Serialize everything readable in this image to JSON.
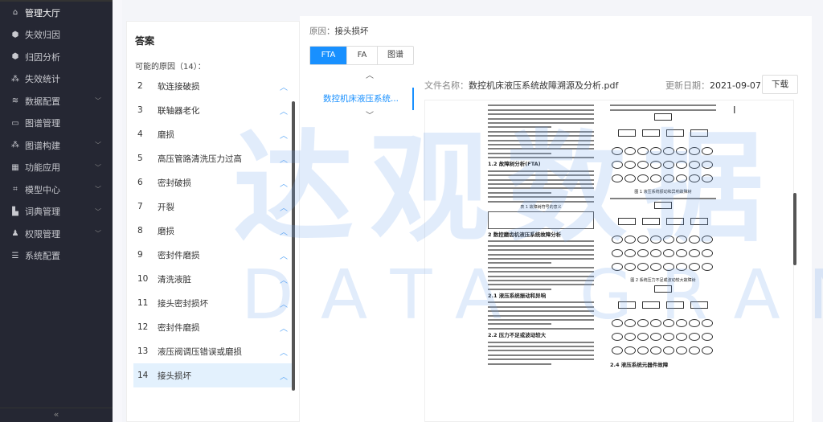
{
  "sidebar": {
    "items": [
      {
        "label": "管理大厅",
        "icon": "home-icon",
        "has_children": false
      },
      {
        "label": "失效归因",
        "icon": "cube-icon",
        "has_children": false
      },
      {
        "label": "归因分析",
        "icon": "cube-icon",
        "has_children": false
      },
      {
        "label": "失效统计",
        "icon": "nodes-icon",
        "has_children": false
      },
      {
        "label": "数据配置",
        "icon": "database-icon",
        "has_children": true
      },
      {
        "label": "图谱管理",
        "icon": "monitor-icon",
        "has_children": false
      },
      {
        "label": "图谱构建",
        "icon": "nodes-icon",
        "has_children": true
      },
      {
        "label": "功能应用",
        "icon": "grid-icon",
        "has_children": true
      },
      {
        "label": "模型中心",
        "icon": "network-icon",
        "has_children": true
      },
      {
        "label": "词典管理",
        "icon": "book-icon",
        "has_children": true
      },
      {
        "label": "权限管理",
        "icon": "user-lock-icon",
        "has_children": true
      },
      {
        "label": "系统配置",
        "icon": "settings-panel-icon",
        "has_children": false
      }
    ],
    "collapse": "«"
  },
  "answer": {
    "title": "答案",
    "count_label": "可能的原因（14）：",
    "items": [
      {
        "num": "2",
        "label": "软连接破损"
      },
      {
        "num": "3",
        "label": "联轴器老化"
      },
      {
        "num": "4",
        "label": "磨损"
      },
      {
        "num": "5",
        "label": "高压管路清洗压力过高"
      },
      {
        "num": "6",
        "label": "密封破损"
      },
      {
        "num": "7",
        "label": "开裂"
      },
      {
        "num": "8",
        "label": "磨损"
      },
      {
        "num": "9",
        "label": "密封件磨损"
      },
      {
        "num": "10",
        "label": "清洗液脏"
      },
      {
        "num": "11",
        "label": "接头密封损坏"
      },
      {
        "num": "12",
        "label": "密封件磨损"
      },
      {
        "num": "13",
        "label": "液压阀调压错误或磨损"
      },
      {
        "num": "14",
        "label": "接头损坏",
        "selected": true
      }
    ]
  },
  "detail": {
    "reason_label": "原因：",
    "reason_value": "接头损坏",
    "tabs": [
      {
        "label": "FTA",
        "active": true
      },
      {
        "label": "FA"
      },
      {
        "label": "图谱"
      }
    ],
    "documents": [
      {
        "label": "数控机床液压系统...",
        "active": true
      }
    ],
    "file_label": "文件名称：",
    "file_name": "数控机床液压系统故障溯源及分析.pdf",
    "date_label": "更新日期：",
    "date": "2021-09-07",
    "download": "下载",
    "pdf": {
      "headings": [
        "1.2 故障树分析(FTA)",
        "表 1 故障树符号的意义",
        "2 数控磨齿机液压系统故障分析",
        "2.1 液压系统振动和异响",
        "2.2 压力不足或波动较大",
        "图 1 液压系统振动和异响故障树",
        "图 2 系统压力不足或波动较大故障树",
        "2.4 液压系统元器件故障"
      ]
    }
  },
  "watermark": {
    "cn": "达观数据",
    "en": "DATA GRAND"
  },
  "colors": {
    "accent": "#1890ff",
    "sidebar_bg": "#252733",
    "selected_row": "#e3f1fd"
  }
}
